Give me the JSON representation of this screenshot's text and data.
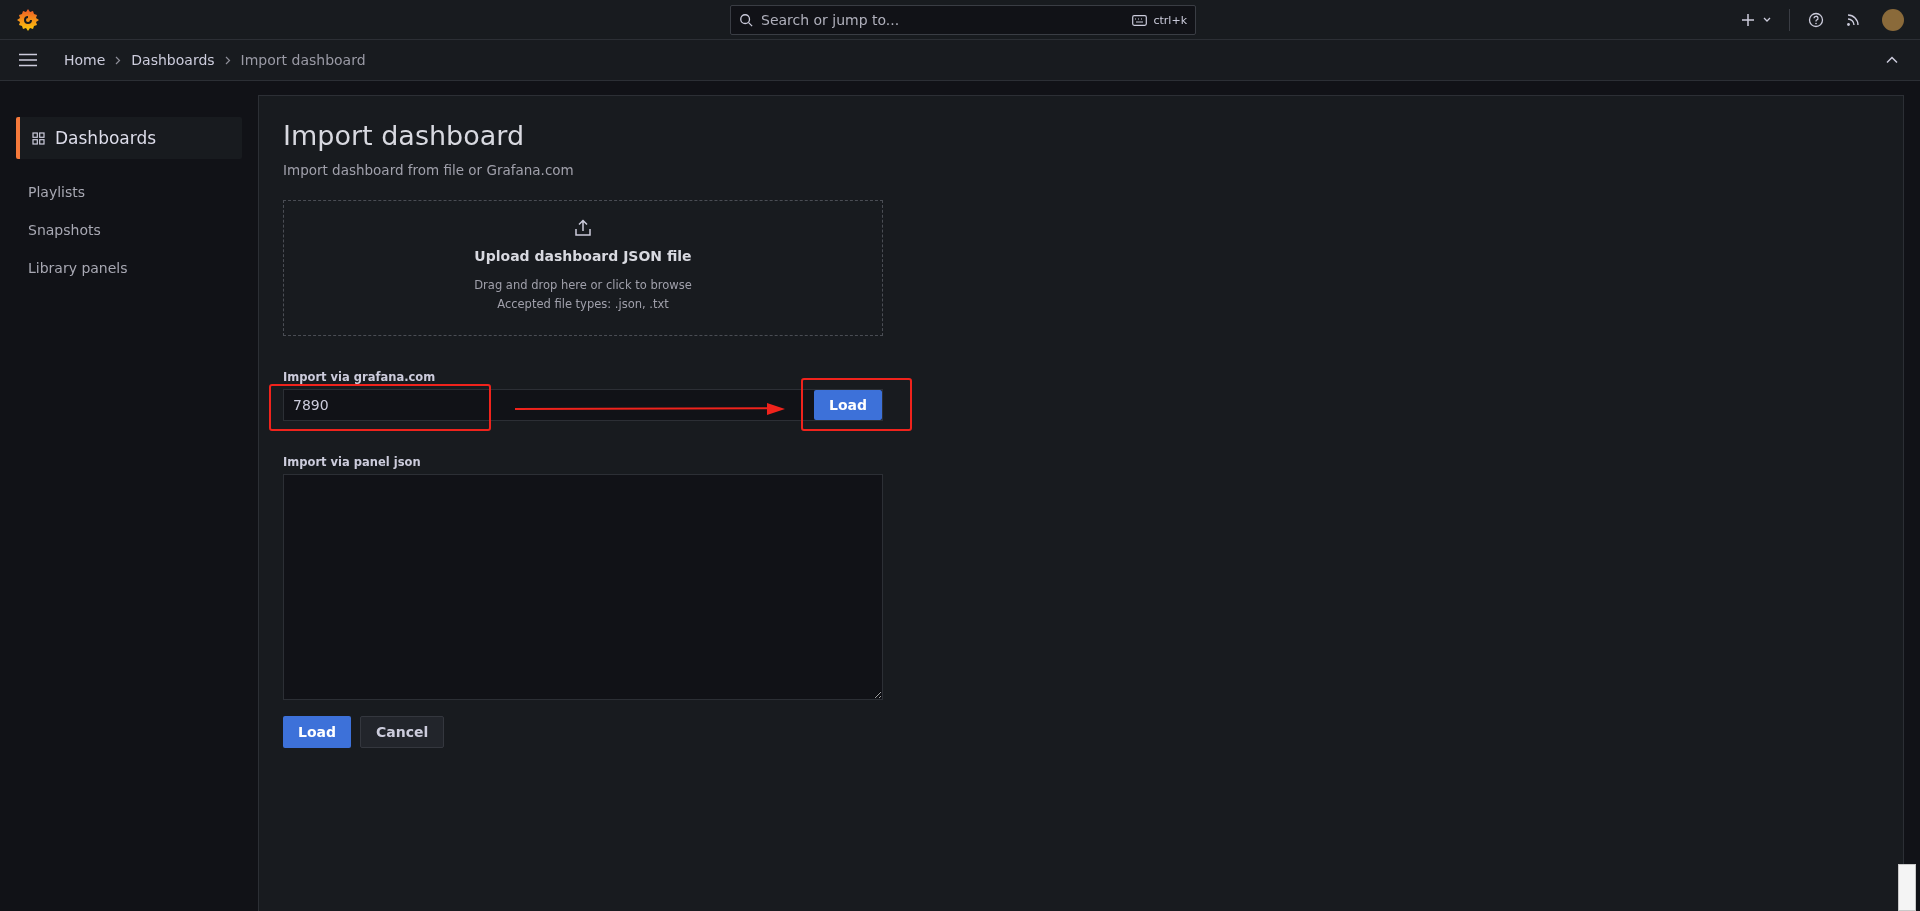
{
  "topbar": {
    "search": {
      "placeholder": "Search or jump to...",
      "shortcut": "ctrl+k"
    }
  },
  "breadcrumbs": [
    {
      "label": "Home",
      "current": false
    },
    {
      "label": "Dashboards",
      "current": false
    },
    {
      "label": "Import dashboard",
      "current": true
    }
  ],
  "sidebar": {
    "items": [
      {
        "label": "Dashboards",
        "selected": true
      },
      {
        "label": "Playlists",
        "selected": false
      },
      {
        "label": "Snapshots",
        "selected": false
      },
      {
        "label": "Library panels",
        "selected": false
      }
    ]
  },
  "page": {
    "title": "Import dashboard",
    "subtitle": "Import dashboard from file or Grafana.com",
    "upload": {
      "title": "Upload dashboard JSON file",
      "hint": "Drag and drop here or click to browse",
      "types": "Accepted file types: .json, .txt"
    },
    "grafana_import": {
      "label": "Import via grafana.com",
      "value": "7890",
      "button": "Load"
    },
    "panel_json": {
      "label": "Import via panel json"
    },
    "buttons": [
      {
        "label": "Load",
        "kind": "primary"
      },
      {
        "label": "Cancel",
        "kind": "secondary"
      }
    ]
  }
}
